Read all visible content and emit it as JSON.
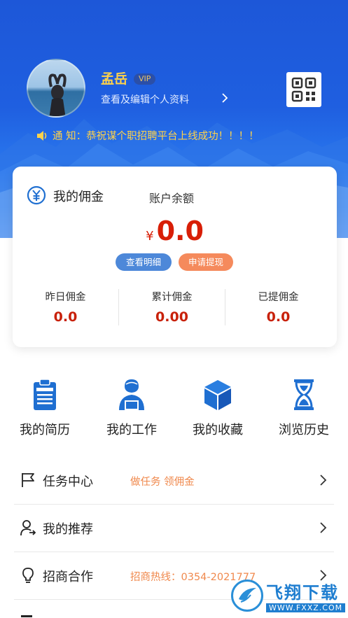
{
  "profile": {
    "name": "孟岳",
    "vip_label": "VIP",
    "edit_link": "查看及编辑个人资料"
  },
  "notice": {
    "text": "通 知：恭祝谋个职招聘平台上线成功！！！！"
  },
  "commission": {
    "title": "我的佣金",
    "balance_label": "账户余额",
    "currency_symbol": "¥",
    "balance": "0.0",
    "detail_button": "查看明细",
    "withdraw_button": "申请提现",
    "stats": [
      {
        "label": "昨日佣金",
        "value": "0.0"
      },
      {
        "label": "累计佣金",
        "value": "0.00"
      },
      {
        "label": "已提佣金",
        "value": "0.0"
      }
    ]
  },
  "shortcuts": [
    {
      "label": "我的简历",
      "icon": "resume-icon"
    },
    {
      "label": "我的工作",
      "icon": "worker-icon"
    },
    {
      "label": "我的收藏",
      "icon": "cube-icon"
    },
    {
      "label": "浏览历史",
      "icon": "hourglass-icon"
    }
  ],
  "menu": [
    {
      "label": "任务中心",
      "hint": "做任务 领佣金",
      "icon": "flag-icon"
    },
    {
      "label": "我的推荐",
      "hint": "",
      "icon": "user-share-icon"
    },
    {
      "label": "招商合作",
      "hint": "招商热线：0354-2021777",
      "icon": "lightbulb-icon"
    }
  ],
  "watermark": {
    "title": "飞翔下载",
    "url": "WWW.FXXZ.COM"
  },
  "colors": {
    "hero_blue": "#1f5fe0",
    "accent_red": "#d81e06",
    "hint_orange": "#f0894d",
    "vip_gold": "#ffd24a",
    "icon_blue": "#1f6fd1"
  }
}
